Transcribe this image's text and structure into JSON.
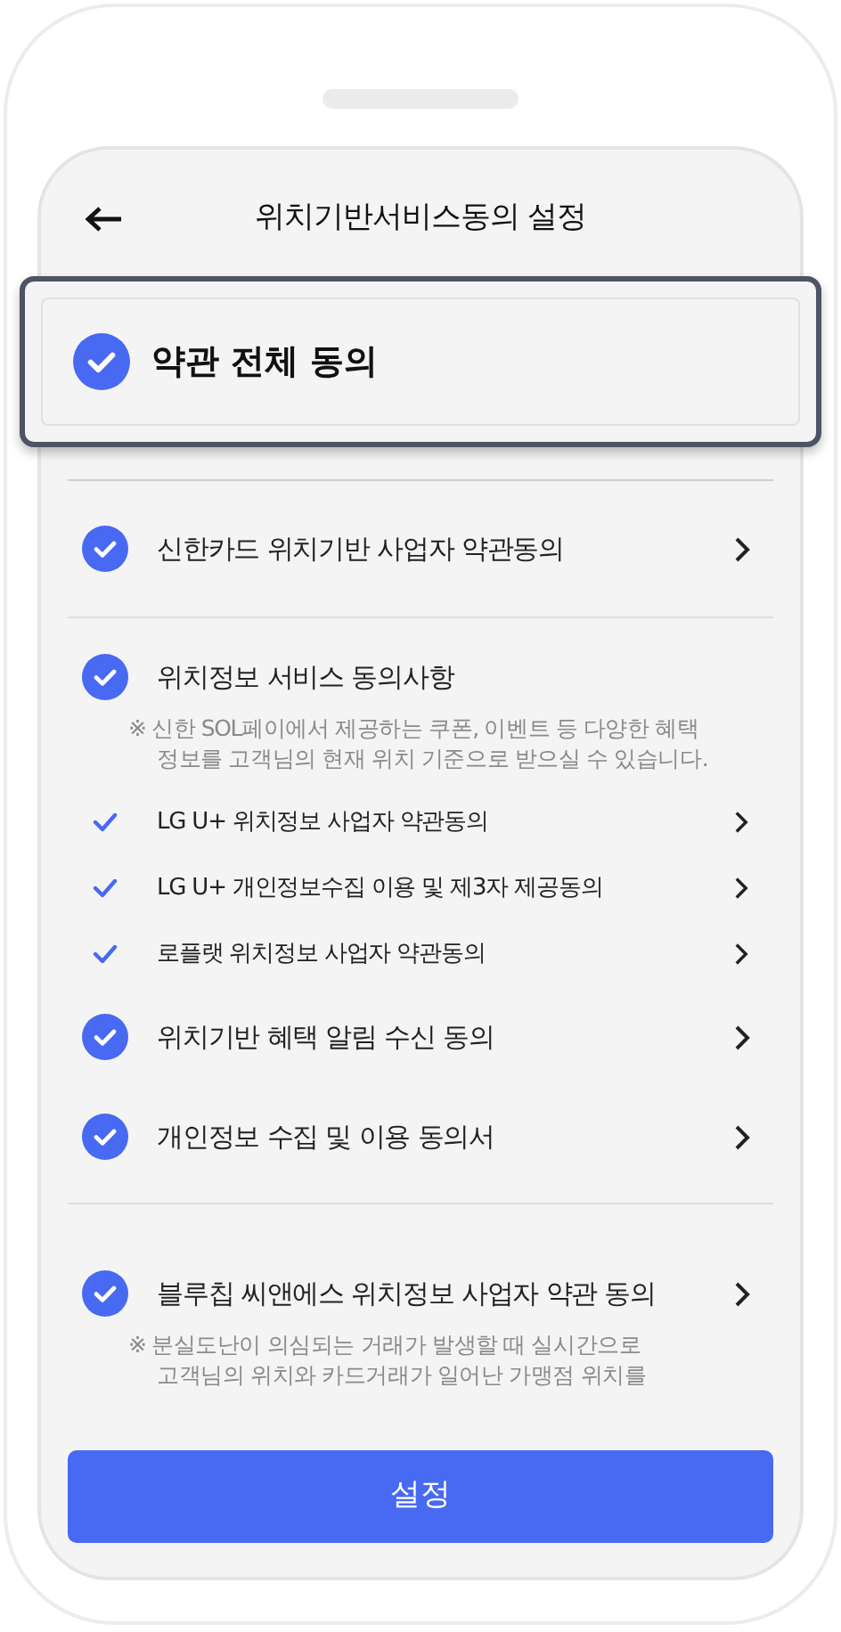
{
  "header": {
    "title": "위치기반서비스동의 설정"
  },
  "agree_all": {
    "label": "약관 전체 동의",
    "checked": true
  },
  "sections": [
    {
      "items": [
        {
          "kind": "main",
          "label": "신한카드 위치기반 사업자 약관동의",
          "checked": true,
          "arrow": true
        }
      ]
    },
    {
      "items": [
        {
          "kind": "main",
          "label": "위치정보 서비스 동의사항",
          "checked": true,
          "arrow": false
        },
        {
          "kind": "note",
          "lines": [
            "※ 신한 SOL페이에서 제공하는 쿠폰, 이벤트 등 다양한 혜택",
            "정보를 고객님의 현재 위치 기준으로 받으실 수 있습니다."
          ]
        },
        {
          "kind": "sub",
          "label": "LG U+ 위치정보 사업자 약관동의",
          "checked": true,
          "arrow": true
        },
        {
          "kind": "sub",
          "label": "LG U+ 개인정보수집 이용 및 제3자 제공동의",
          "checked": true,
          "arrow": true
        },
        {
          "kind": "sub",
          "label": "로플랫 위치정보 사업자 약관동의",
          "checked": true,
          "arrow": true
        },
        {
          "kind": "main",
          "label": "위치기반 혜택 알림 수신 동의",
          "checked": true,
          "arrow": true
        },
        {
          "kind": "main",
          "label": "개인정보 수집 및 이용 동의서",
          "checked": true,
          "arrow": true
        }
      ]
    },
    {
      "items": [
        {
          "kind": "main",
          "label": "블루칩 씨앤에스 위치정보 사업자 약관 동의",
          "checked": true,
          "arrow": true
        },
        {
          "kind": "note",
          "lines": [
            "※ 분실도난이 의심되는 거래가 발생할 때 실시간으로",
            "고객님의 위치와 카드거래가 일어난 가맹점 위치를"
          ]
        }
      ]
    }
  ],
  "submit": {
    "label": "설정"
  }
}
